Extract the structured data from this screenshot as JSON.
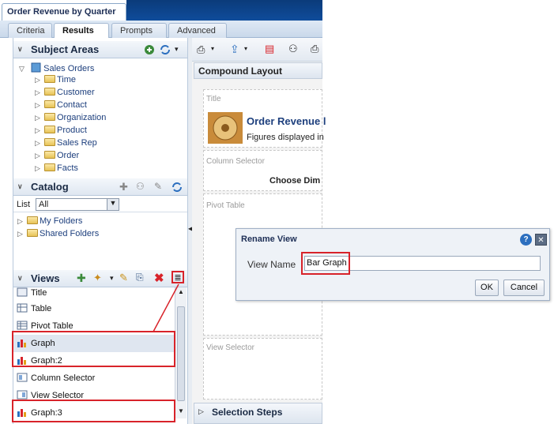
{
  "document": {
    "title": "Order Revenue by Quarter"
  },
  "tabs": [
    {
      "label": "Criteria",
      "active": false
    },
    {
      "label": "Results",
      "active": true
    },
    {
      "label": "Prompts",
      "active": false
    },
    {
      "label": "Advanced",
      "active": false
    }
  ],
  "subject_areas": {
    "title": "Subject Areas",
    "root": "Sales Orders",
    "items": [
      "Time",
      "Customer",
      "Contact",
      "Organization",
      "Product",
      "Sales Rep",
      "Order",
      "Facts"
    ]
  },
  "catalog": {
    "title": "Catalog",
    "list_label": "List",
    "list_value": "All",
    "folders": [
      "My Folders",
      "Shared Folders"
    ]
  },
  "views": {
    "title": "Views",
    "items": [
      "Title",
      "Table",
      "Pivot Table",
      "Graph",
      "Graph:2",
      "Column Selector",
      "View Selector",
      "Graph:3"
    ]
  },
  "compound_layout": {
    "title": "Compound Layout",
    "title_section_label": "Title",
    "heading": "Order Revenue l",
    "subtext": "Figures displayed in",
    "column_selector_label": "Column Selector",
    "choose_dim": "Choose Dim",
    "pivot_table_label": "Pivot Table",
    "view_selector_label": "View Selector",
    "selection_steps": "Selection Steps"
  },
  "rename_dialog": {
    "title": "Rename View",
    "field_label": "View Name",
    "field_value": "Bar Graph",
    "ok": "OK",
    "cancel": "Cancel"
  },
  "colors": {
    "accent_red": "#d8232a",
    "header_blue": "#0f4c9b",
    "link_blue": "#1d3f7d"
  }
}
